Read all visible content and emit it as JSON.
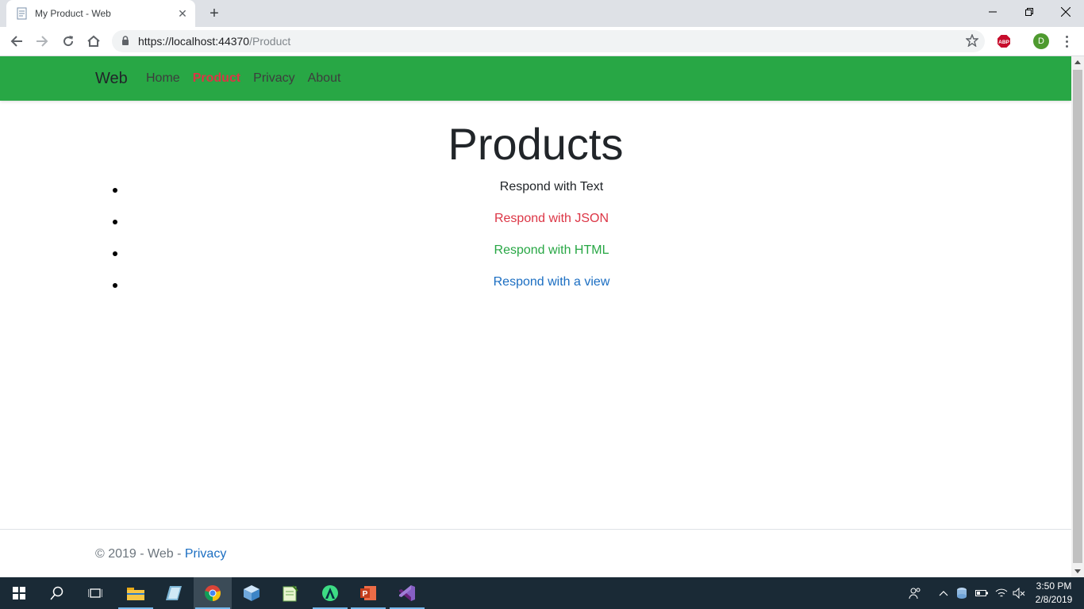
{
  "browser": {
    "tab_title": "My Product - Web",
    "url_host": "https://localhost:44370",
    "url_path": "/Product",
    "abp_label": "ABP",
    "profile_initial": "D"
  },
  "nav": {
    "brand": "Web",
    "links": [
      {
        "label": "Home",
        "active": false
      },
      {
        "label": "Product",
        "active": true
      },
      {
        "label": "Privacy",
        "active": false
      },
      {
        "label": "About",
        "active": false
      }
    ]
  },
  "main": {
    "title": "Products",
    "items": [
      {
        "label": "Respond with Text",
        "color": "#212529"
      },
      {
        "label": "Respond with JSON",
        "color": "#dc3545"
      },
      {
        "label": "Respond with HTML",
        "color": "#28a745"
      },
      {
        "label": "Respond with a view",
        "color": "#1b6ec2"
      }
    ]
  },
  "footer": {
    "text": "© 2019 - Web - ",
    "link": "Privacy"
  },
  "taskbar": {
    "time": "3:50 PM",
    "date": "2/8/2019"
  },
  "colors": {
    "navbar": "#28a745",
    "active_link": "#dc3545",
    "link_blue": "#1b6ec2",
    "taskbar": "#1a2a36"
  }
}
